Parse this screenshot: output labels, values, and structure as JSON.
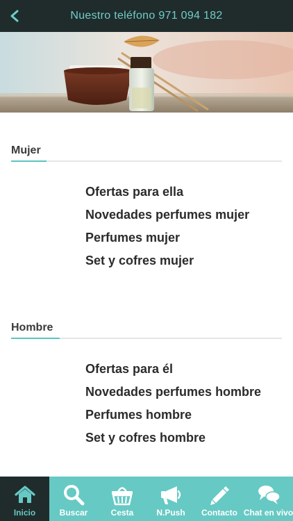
{
  "header": {
    "back_icon": "chevron-left-icon",
    "title": "Nuestro teléfono 971 094 182"
  },
  "sections": [
    {
      "title": "Mujer",
      "items": [
        "Ofertas para ella",
        "Novedades perfumes mujer",
        "Perfumes mujer",
        "Set y cofres mujer"
      ]
    },
    {
      "title": "Hombre",
      "items": [
        "Ofertas para él",
        "Novedades perfumes hombre",
        "Perfumes hombre",
        "Set y cofres hombre"
      ]
    }
  ],
  "tabbar": {
    "tabs": [
      {
        "label": "Inicio",
        "icon": "home-icon",
        "active": true
      },
      {
        "label": "Buscar",
        "icon": "search-icon",
        "active": false
      },
      {
        "label": "Cesta",
        "icon": "basket-icon",
        "active": false
      },
      {
        "label": "N.Push",
        "icon": "megaphone-icon",
        "active": false
      },
      {
        "label": "Contacto",
        "icon": "pencil-icon",
        "active": false
      },
      {
        "label": "Chat en vivo",
        "icon": "chat-icon",
        "active": false
      }
    ]
  },
  "colors": {
    "topbar_bg": "#202c2c",
    "accent": "#5bc4c1",
    "tabbar_bg": "#66c9c4"
  }
}
